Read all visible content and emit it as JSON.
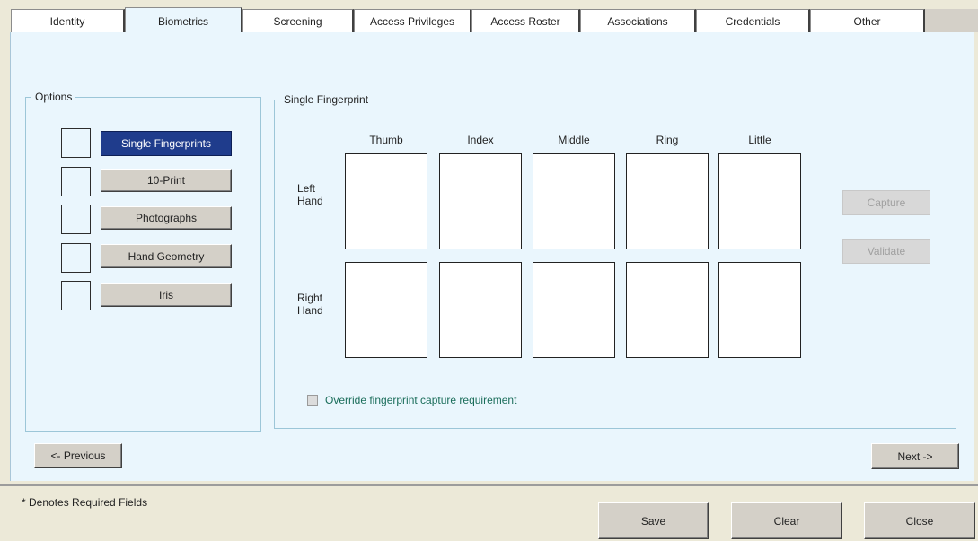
{
  "tabs": [
    {
      "label": "Identity",
      "active": false
    },
    {
      "label": "Biometrics",
      "active": true
    },
    {
      "label": "Screening",
      "active": false
    },
    {
      "label": "Access Privileges",
      "active": false
    },
    {
      "label": "Access Roster",
      "active": false
    },
    {
      "label": "Associations",
      "active": false
    },
    {
      "label": "Credentials",
      "active": false
    },
    {
      "label": "Other",
      "active": false
    }
  ],
  "options": {
    "legend": "Options",
    "items": [
      {
        "label": "Single Fingerprints",
        "selected": true
      },
      {
        "label": "10-Print",
        "selected": false
      },
      {
        "label": "Photographs",
        "selected": false
      },
      {
        "label": "Hand Geometry",
        "selected": false
      },
      {
        "label": "Iris",
        "selected": false
      }
    ]
  },
  "fingerprint": {
    "legend": "Single Fingerprint",
    "columns": [
      "Thumb",
      "Index",
      "Middle",
      "Ring",
      "Little"
    ],
    "rows": [
      {
        "label": "Left Hand"
      },
      {
        "label": "Right Hand"
      }
    ],
    "capture_label": "Capture",
    "validate_label": "Validate",
    "override_label": "Override fingerprint capture requirement",
    "override_checked": false
  },
  "nav": {
    "previous_label": "<- Previous",
    "next_label": "Next ->"
  },
  "footer": {
    "note": "* Denotes Required Fields",
    "save_label": "Save",
    "clear_label": "Clear",
    "close_label": "Close"
  },
  "colors": {
    "panel_bg": "#eaf6fd",
    "selected_button": "#1f3c8c",
    "override_text": "#1a6d5a"
  }
}
